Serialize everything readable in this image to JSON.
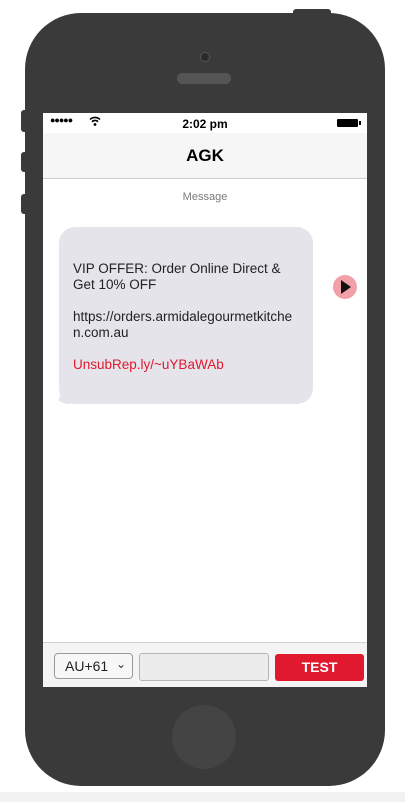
{
  "status_bar": {
    "time": "2:02 pm",
    "signal_dots": "●●●●●"
  },
  "header": {
    "contact_name": "AGK"
  },
  "conversation": {
    "label": "Message",
    "message": {
      "line1": "VIP OFFER: Order Online Direct & Get 10% OFF",
      "line2": "https://orders.armidalegourmetkitchen.com.au",
      "unsubscribe": "UnsubRep.ly/~uYBaWAb"
    }
  },
  "composer": {
    "country_code": "AU+61",
    "phone_value": "",
    "test_label": "TEST"
  },
  "colors": {
    "accent": "#e0192e",
    "bubble": "#e4e4ea",
    "phone_frame": "#3a3a3a"
  },
  "icons": [
    "signal-dots-icon",
    "wifi-icon",
    "battery-icon",
    "play-icon",
    "chevron-down-icon"
  ]
}
